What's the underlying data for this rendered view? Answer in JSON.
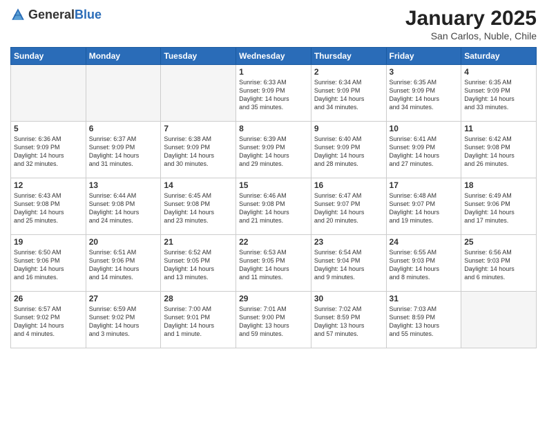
{
  "header": {
    "logo_general": "General",
    "logo_blue": "Blue",
    "month_title": "January 2025",
    "subtitle": "San Carlos, Nuble, Chile"
  },
  "days_of_week": [
    "Sunday",
    "Monday",
    "Tuesday",
    "Wednesday",
    "Thursday",
    "Friday",
    "Saturday"
  ],
  "weeks": [
    [
      {
        "day": "",
        "info": ""
      },
      {
        "day": "",
        "info": ""
      },
      {
        "day": "",
        "info": ""
      },
      {
        "day": "1",
        "info": "Sunrise: 6:33 AM\nSunset: 9:09 PM\nDaylight: 14 hours\nand 35 minutes."
      },
      {
        "day": "2",
        "info": "Sunrise: 6:34 AM\nSunset: 9:09 PM\nDaylight: 14 hours\nand 34 minutes."
      },
      {
        "day": "3",
        "info": "Sunrise: 6:35 AM\nSunset: 9:09 PM\nDaylight: 14 hours\nand 34 minutes."
      },
      {
        "day": "4",
        "info": "Sunrise: 6:35 AM\nSunset: 9:09 PM\nDaylight: 14 hours\nand 33 minutes."
      }
    ],
    [
      {
        "day": "5",
        "info": "Sunrise: 6:36 AM\nSunset: 9:09 PM\nDaylight: 14 hours\nand 32 minutes."
      },
      {
        "day": "6",
        "info": "Sunrise: 6:37 AM\nSunset: 9:09 PM\nDaylight: 14 hours\nand 31 minutes."
      },
      {
        "day": "7",
        "info": "Sunrise: 6:38 AM\nSunset: 9:09 PM\nDaylight: 14 hours\nand 30 minutes."
      },
      {
        "day": "8",
        "info": "Sunrise: 6:39 AM\nSunset: 9:09 PM\nDaylight: 14 hours\nand 29 minutes."
      },
      {
        "day": "9",
        "info": "Sunrise: 6:40 AM\nSunset: 9:09 PM\nDaylight: 14 hours\nand 28 minutes."
      },
      {
        "day": "10",
        "info": "Sunrise: 6:41 AM\nSunset: 9:09 PM\nDaylight: 14 hours\nand 27 minutes."
      },
      {
        "day": "11",
        "info": "Sunrise: 6:42 AM\nSunset: 9:08 PM\nDaylight: 14 hours\nand 26 minutes."
      }
    ],
    [
      {
        "day": "12",
        "info": "Sunrise: 6:43 AM\nSunset: 9:08 PM\nDaylight: 14 hours\nand 25 minutes."
      },
      {
        "day": "13",
        "info": "Sunrise: 6:44 AM\nSunset: 9:08 PM\nDaylight: 14 hours\nand 24 minutes."
      },
      {
        "day": "14",
        "info": "Sunrise: 6:45 AM\nSunset: 9:08 PM\nDaylight: 14 hours\nand 23 minutes."
      },
      {
        "day": "15",
        "info": "Sunrise: 6:46 AM\nSunset: 9:08 PM\nDaylight: 14 hours\nand 21 minutes."
      },
      {
        "day": "16",
        "info": "Sunrise: 6:47 AM\nSunset: 9:07 PM\nDaylight: 14 hours\nand 20 minutes."
      },
      {
        "day": "17",
        "info": "Sunrise: 6:48 AM\nSunset: 9:07 PM\nDaylight: 14 hours\nand 19 minutes."
      },
      {
        "day": "18",
        "info": "Sunrise: 6:49 AM\nSunset: 9:06 PM\nDaylight: 14 hours\nand 17 minutes."
      }
    ],
    [
      {
        "day": "19",
        "info": "Sunrise: 6:50 AM\nSunset: 9:06 PM\nDaylight: 14 hours\nand 16 minutes."
      },
      {
        "day": "20",
        "info": "Sunrise: 6:51 AM\nSunset: 9:06 PM\nDaylight: 14 hours\nand 14 minutes."
      },
      {
        "day": "21",
        "info": "Sunrise: 6:52 AM\nSunset: 9:05 PM\nDaylight: 14 hours\nand 13 minutes."
      },
      {
        "day": "22",
        "info": "Sunrise: 6:53 AM\nSunset: 9:05 PM\nDaylight: 14 hours\nand 11 minutes."
      },
      {
        "day": "23",
        "info": "Sunrise: 6:54 AM\nSunset: 9:04 PM\nDaylight: 14 hours\nand 9 minutes."
      },
      {
        "day": "24",
        "info": "Sunrise: 6:55 AM\nSunset: 9:03 PM\nDaylight: 14 hours\nand 8 minutes."
      },
      {
        "day": "25",
        "info": "Sunrise: 6:56 AM\nSunset: 9:03 PM\nDaylight: 14 hours\nand 6 minutes."
      }
    ],
    [
      {
        "day": "26",
        "info": "Sunrise: 6:57 AM\nSunset: 9:02 PM\nDaylight: 14 hours\nand 4 minutes."
      },
      {
        "day": "27",
        "info": "Sunrise: 6:59 AM\nSunset: 9:02 PM\nDaylight: 14 hours\nand 3 minutes."
      },
      {
        "day": "28",
        "info": "Sunrise: 7:00 AM\nSunset: 9:01 PM\nDaylight: 14 hours\nand 1 minute."
      },
      {
        "day": "29",
        "info": "Sunrise: 7:01 AM\nSunset: 9:00 PM\nDaylight: 13 hours\nand 59 minutes."
      },
      {
        "day": "30",
        "info": "Sunrise: 7:02 AM\nSunset: 8:59 PM\nDaylight: 13 hours\nand 57 minutes."
      },
      {
        "day": "31",
        "info": "Sunrise: 7:03 AM\nSunset: 8:59 PM\nDaylight: 13 hours\nand 55 minutes."
      },
      {
        "day": "",
        "info": ""
      }
    ]
  ]
}
